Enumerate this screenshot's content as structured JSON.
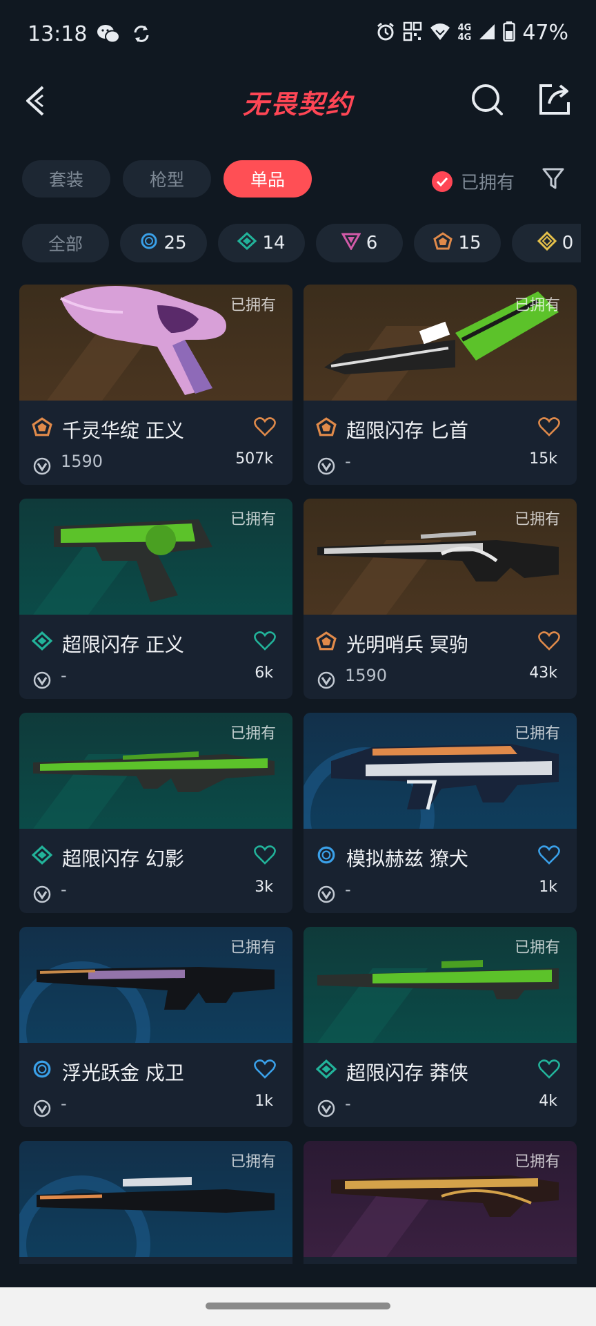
{
  "status_bar": {
    "time": "13:18",
    "battery": "47%",
    "network_top": "4G",
    "network_bottom": "4G"
  },
  "header": {
    "title": "无畏契约"
  },
  "tabs": [
    {
      "label": "套装",
      "active": false
    },
    {
      "label": "枪型",
      "active": false
    },
    {
      "label": "单品",
      "active": true
    }
  ],
  "owned_filter": {
    "label": "已拥有",
    "checked": true
  },
  "rarity_chips": [
    {
      "label": "全部",
      "icon": "all"
    },
    {
      "count": "25",
      "icon": "select-tier-icon",
      "color": "#3aa0e8"
    },
    {
      "count": "14",
      "icon": "deluxe-tier-icon",
      "color": "#22b39a"
    },
    {
      "count": "6",
      "icon": "premium-tier-icon",
      "color": "#d25aa8"
    },
    {
      "count": "15",
      "icon": "exclusive-tier-icon",
      "color": "#e08a4a"
    },
    {
      "count": "0",
      "icon": "ultra-tier-icon",
      "color": "#e5c04a"
    }
  ],
  "cards": [
    {
      "name": "千灵华绽 正义",
      "price": "1590",
      "count": "507k",
      "tier": "exclusive",
      "owned_label": "已拥有"
    },
    {
      "name": "超限闪存 匕首",
      "price": "-",
      "count": "15k",
      "tier": "exclusive",
      "owned_label": "已拥有"
    },
    {
      "name": "超限闪存 正义",
      "price": "-",
      "count": "6k",
      "tier": "deluxe",
      "owned_label": "已拥有"
    },
    {
      "name": "光明哨兵 冥驹",
      "price": "1590",
      "count": "43k",
      "tier": "exclusive",
      "owned_label": "已拥有"
    },
    {
      "name": "超限闪存 幻影",
      "price": "-",
      "count": "3k",
      "tier": "deluxe",
      "owned_label": "已拥有"
    },
    {
      "name": "模拟赫兹 獠犬",
      "price": "-",
      "count": "1k",
      "tier": "select",
      "owned_label": "已拥有"
    },
    {
      "name": "浮光跃金 戍卫",
      "price": "-",
      "count": "1k",
      "tier": "select",
      "owned_label": "已拥有"
    },
    {
      "name": "超限闪存 莽侠",
      "price": "-",
      "count": "4k",
      "tier": "deluxe",
      "owned_label": "已拥有"
    },
    {
      "name": "",
      "price": "",
      "count": "",
      "tier": "select",
      "owned_label": "已拥有"
    },
    {
      "name": "",
      "price": "",
      "count": "",
      "tier": "premium",
      "owned_label": "已拥有"
    }
  ],
  "colors": {
    "accent": "#ff4655",
    "exclusive": "#e08a4a",
    "deluxe": "#22b39a",
    "select": "#3aa0e8",
    "premium": "#d25aa8"
  }
}
